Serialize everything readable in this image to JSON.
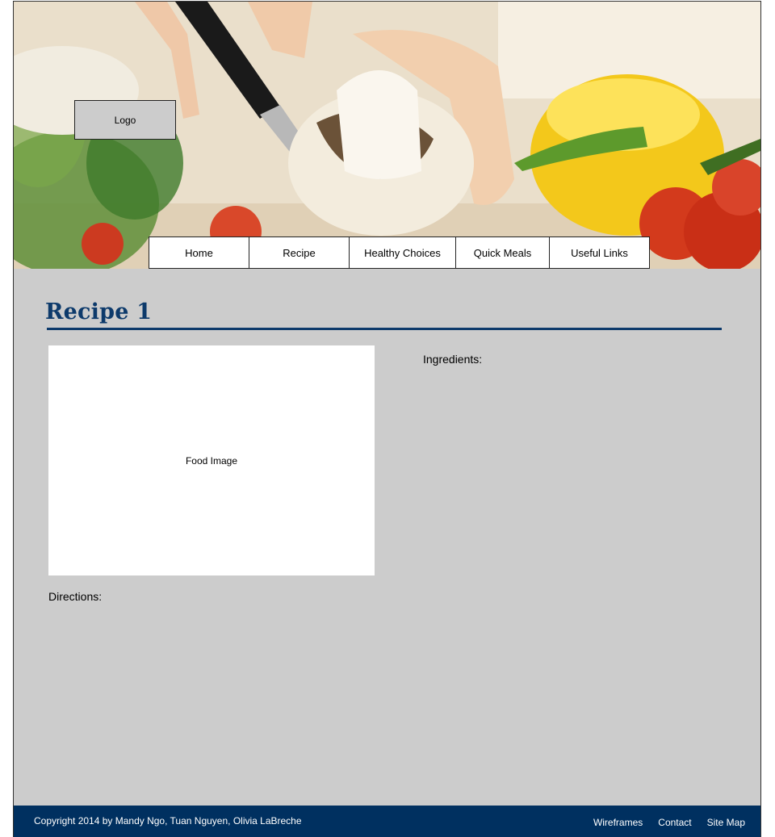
{
  "header": {
    "logo_text": "Logo",
    "hero_image": "kitchen-vegetables-photo"
  },
  "nav": {
    "items": [
      {
        "label": "Home"
      },
      {
        "label": "Recipe"
      },
      {
        "label": "Healthy Choices"
      },
      {
        "label": "Quick Meals"
      },
      {
        "label": "Useful Links"
      }
    ]
  },
  "main": {
    "title": "Recipe 1",
    "image_placeholder": "Food Image",
    "ingredients_label": "Ingredients:",
    "directions_label": "Directions:"
  },
  "footer": {
    "copyright": "Copyright  2014 by Mandy Ngo, Tuan Nguyen, Olivia LaBreche",
    "links": [
      {
        "label": "Wireframes"
      },
      {
        "label": "Contact"
      },
      {
        "label": "Site Map"
      }
    ]
  },
  "colors": {
    "title": "#0d3a6b",
    "footer_bg": "#003060",
    "content_bg": "#cccccc"
  }
}
